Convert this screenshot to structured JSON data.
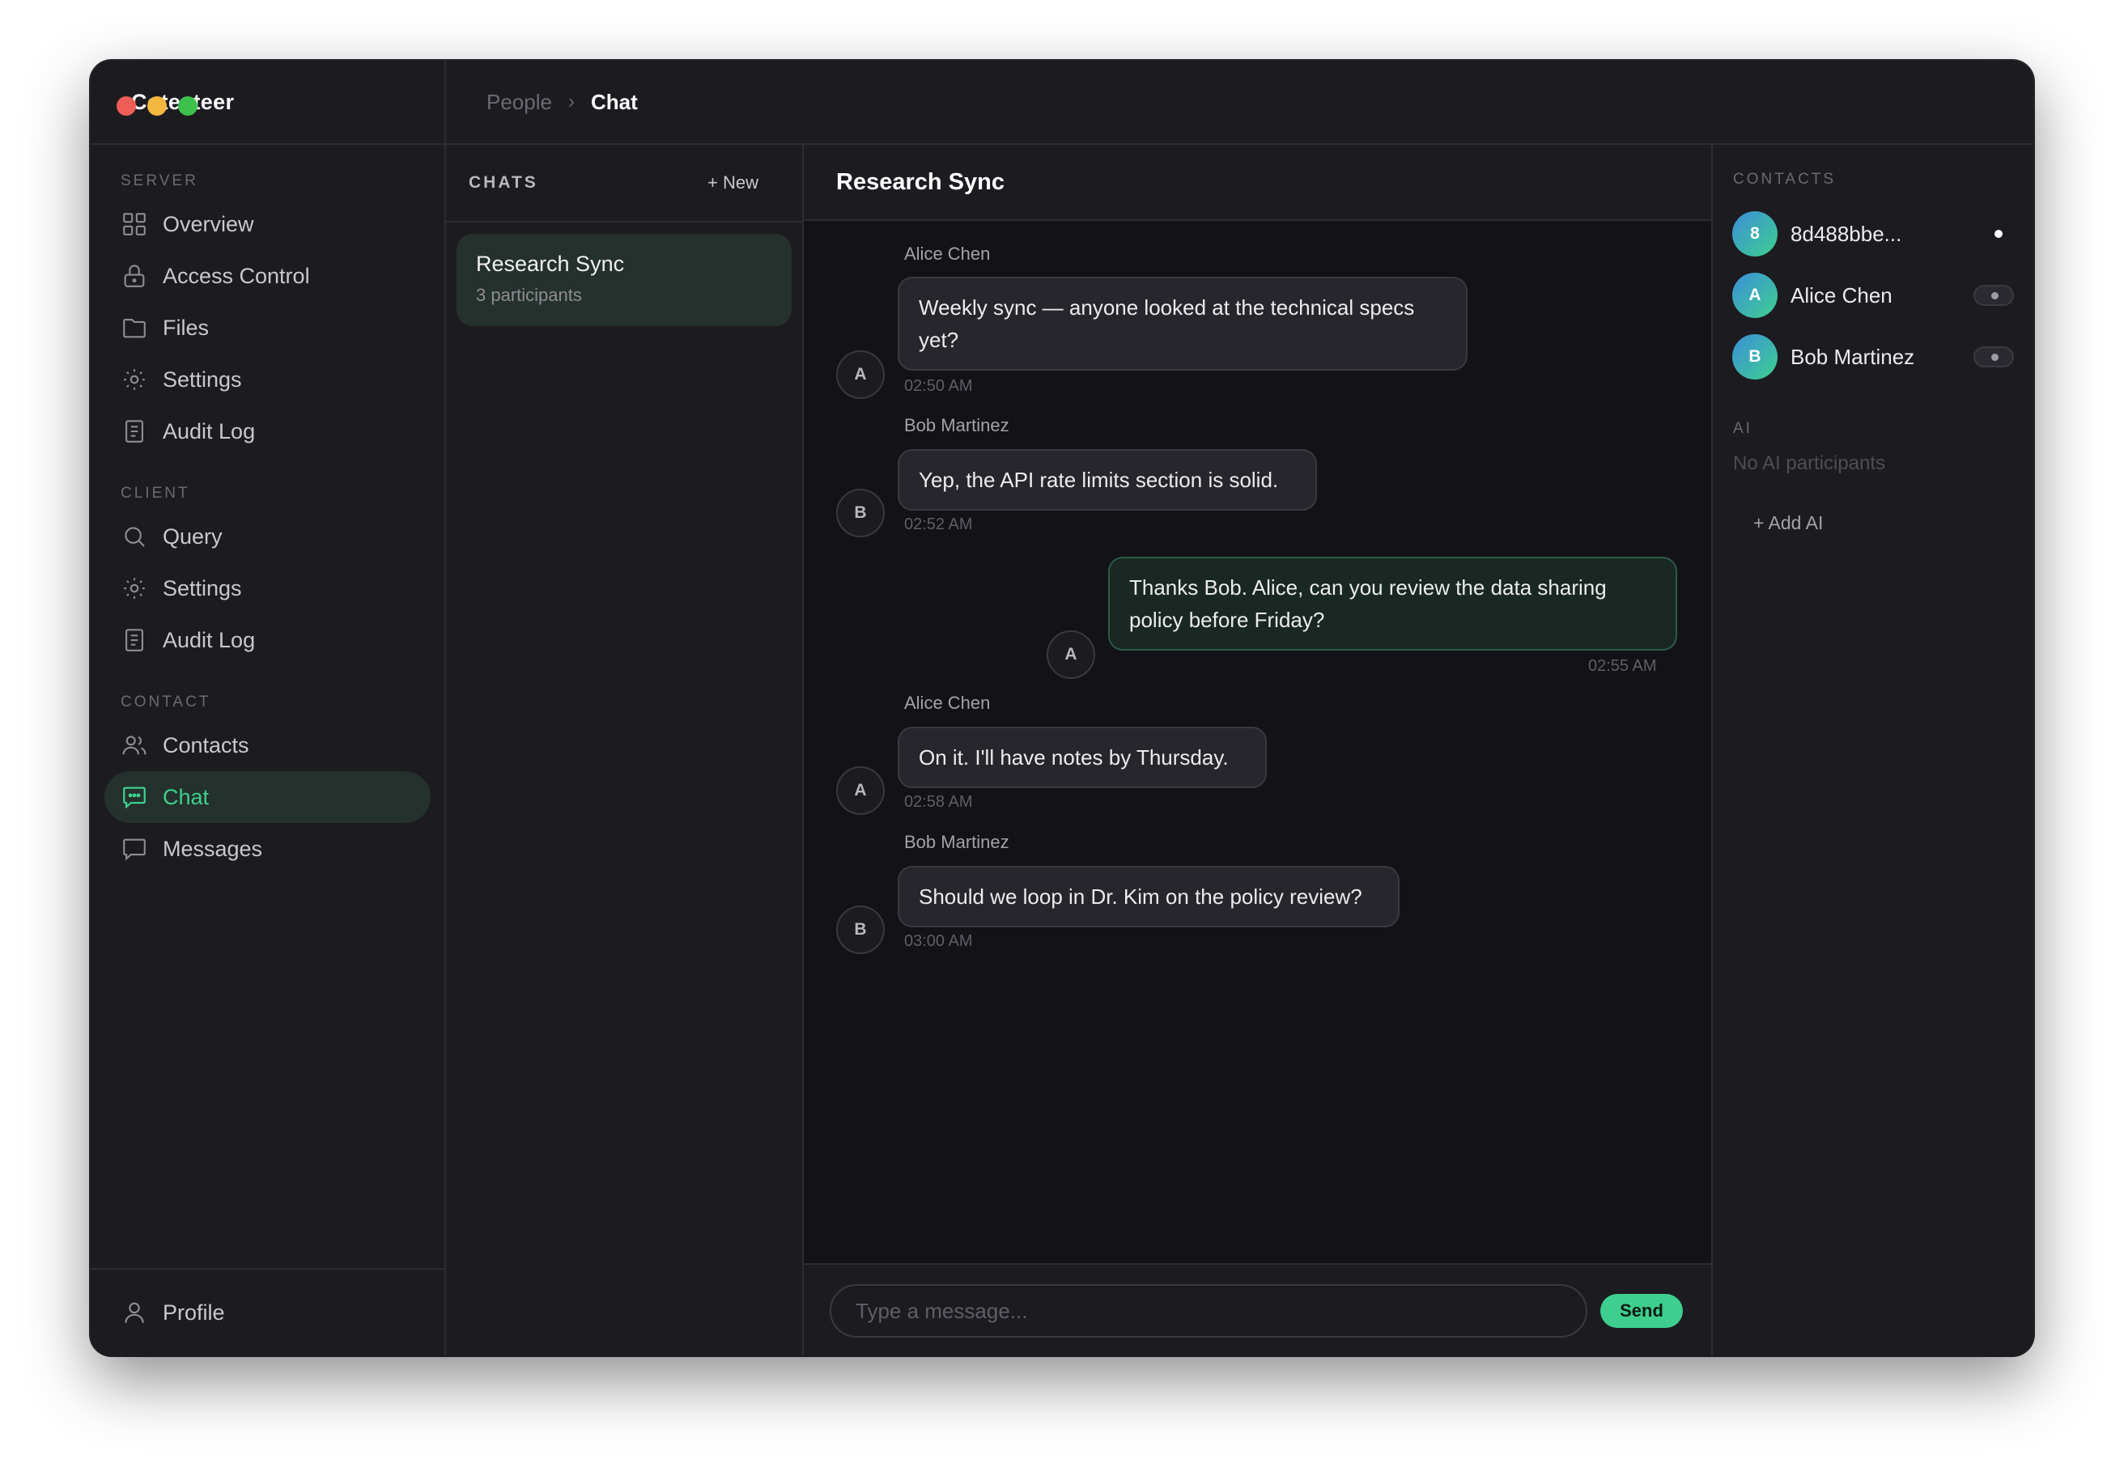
{
  "app": {
    "brand": "Coteeteer",
    "traffic_colors": [
      "#ee5e56",
      "#f4b73e",
      "#3ec04c"
    ]
  },
  "breadcrumb": {
    "parent": "People",
    "separator": "›",
    "current": "Chat"
  },
  "sidebar": {
    "sections": [
      {
        "label": "SERVER",
        "items": [
          {
            "label": "Overview",
            "icon": "grid-icon"
          },
          {
            "label": "Access Control",
            "icon": "lock-icon"
          },
          {
            "label": "Files",
            "icon": "folder-icon"
          },
          {
            "label": "Settings",
            "icon": "gear-icon"
          },
          {
            "label": "Audit Log",
            "icon": "document-icon"
          }
        ]
      },
      {
        "label": "CLIENT",
        "items": [
          {
            "label": "Query",
            "icon": "search-icon"
          },
          {
            "label": "Settings",
            "icon": "gear-icon"
          },
          {
            "label": "Audit Log",
            "icon": "document-icon"
          }
        ]
      },
      {
        "label": "CONTACT",
        "items": [
          {
            "label": "Contacts",
            "icon": "users-icon"
          },
          {
            "label": "Chat",
            "icon": "chat-icon",
            "active": true
          },
          {
            "label": "Messages",
            "icon": "message-icon"
          }
        ]
      }
    ],
    "profile_label": "Profile"
  },
  "chats_panel": {
    "title": "CHATS",
    "new_label": "+ New",
    "items": [
      {
        "title": "Research Sync",
        "subtitle": "3 participants"
      }
    ]
  },
  "conversation": {
    "title": "Research Sync",
    "messages": [
      {
        "sender": "Alice Chen",
        "initial": "A",
        "text": "Weekly sync — anyone looked at the technical specs yet?",
        "time": "02:50 AM",
        "own": false
      },
      {
        "sender": "Bob Martinez",
        "initial": "B",
        "text": "Yep, the API rate limits section is solid.",
        "time": "02:52 AM",
        "own": false
      },
      {
        "sender": "",
        "initial": "A",
        "text": "Thanks Bob. Alice, can you review the data sharing policy before Friday?",
        "time": "02:55 AM",
        "own": true
      },
      {
        "sender": "Alice Chen",
        "initial": "A",
        "text": "On it. I'll have notes by Thursday.",
        "time": "02:58 AM",
        "own": false
      },
      {
        "sender": "Bob Martinez",
        "initial": "B",
        "text": "Should we loop in Dr. Kim on the policy review?",
        "time": "03:00 AM",
        "own": false
      }
    ],
    "input_placeholder": "Type a message...",
    "send_label": "Send"
  },
  "right_panel": {
    "contacts_label": "CONTACTS",
    "contacts": [
      {
        "initial": "8",
        "name": "8d488bbe...",
        "control": "dot"
      },
      {
        "initial": "A",
        "name": "Alice Chen",
        "control": "toggle"
      },
      {
        "initial": "B",
        "name": "Bob Martinez",
        "control": "toggle"
      }
    ],
    "ai_label": "AI",
    "ai_empty": "No AI participants",
    "add_ai_label": "+ Add AI"
  },
  "colors": {
    "accent": "#3ecf8e",
    "background": "#1c1b20",
    "chat_background": "#131217"
  }
}
